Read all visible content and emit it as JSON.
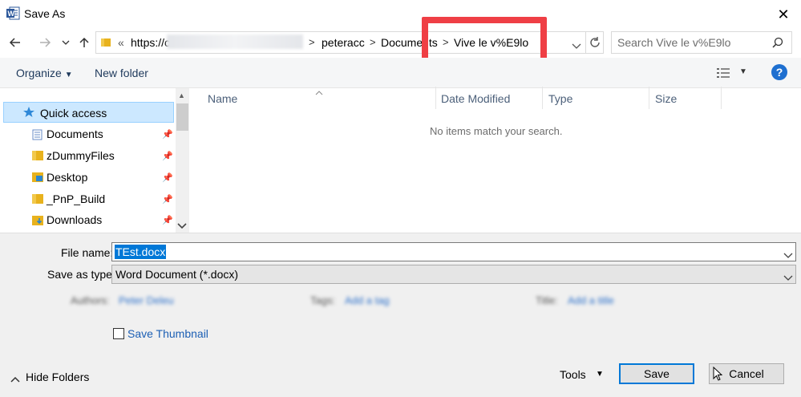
{
  "window": {
    "title": "Save As",
    "app_icon": "word-icon",
    "close": "✕"
  },
  "nav": {
    "back": "back-arrow-icon",
    "forward": "forward-arrow-icon",
    "recent": "chevron-down-icon",
    "up": "up-arrow-icon",
    "breadcrumb": {
      "overflow": "«",
      "items": [
        "https://c",
        "peteracc",
        "Documents",
        "Vive le v%E9lo"
      ]
    },
    "refresh": "refresh-icon",
    "search_placeholder": "Search Vive le v%E9lo"
  },
  "toolbar": {
    "organize": "Organize",
    "new_folder": "New folder",
    "help": "?"
  },
  "sidebar": {
    "quick_access": "Quick access",
    "items": [
      {
        "label": "Documents",
        "pinned": true
      },
      {
        "label": "zDummyFiles",
        "pinned": true
      },
      {
        "label": "Desktop",
        "pinned": true
      },
      {
        "label": "_PnP_Build",
        "pinned": true
      },
      {
        "label": "Downloads",
        "pinned": true
      }
    ]
  },
  "file_list": {
    "columns": [
      "Name",
      "Date Modified",
      "Type",
      "Size"
    ],
    "empty_message": "No items match your search."
  },
  "form": {
    "file_name_label": "File name:",
    "file_name_value": "TEst.docx",
    "save_type_label": "Save as type:",
    "save_type_value": "Word Document (*.docx)",
    "authors_label": "Authors:",
    "authors_value": "Peter Deleu",
    "tags_label": "Tags:",
    "tags_value": "Add a tag",
    "title_label": "Title:",
    "title_value": "Add a title",
    "save_thumbnail": "Save Thumbnail"
  },
  "footer": {
    "hide_folders": "Hide Folders",
    "tools": "Tools",
    "save": "Save",
    "cancel": "Cancel"
  },
  "colors": {
    "accent": "#0078d7",
    "highlight": "#ef3f45",
    "selection": "#cce8ff"
  }
}
